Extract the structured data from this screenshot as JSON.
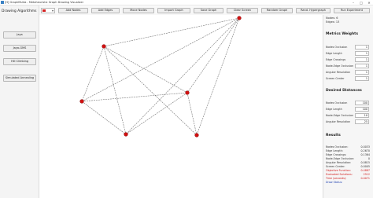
{
  "window": {
    "title": "[H] GraphMutta - Metaheuristic Graph Drawing Visualizer",
    "minimize": "–",
    "maximize": "□",
    "close": "✕"
  },
  "toolbar": {
    "node_color": "#d32020",
    "buttons": [
      "Add Nodes",
      "Add Edges",
      "Move Nodes",
      "Import Graph",
      "Save Graph",
      "Clear Screen",
      "Random Graph",
      "Rand. Hypergraph",
      "Run Experiment"
    ]
  },
  "sidebar": {
    "title": "Drawing Algorithms",
    "buttons": [
      "Jaya",
      "Jaya-GMS",
      "Hill Climbing",
      "Simulated Annealing"
    ]
  },
  "graph": {
    "node_color": "#d01010",
    "edge_color": "#777777",
    "nodes": [
      "N1",
      "N2",
      "N3",
      "N4",
      "N5",
      "N6"
    ],
    "edges": [
      [
        0,
        1
      ],
      [
        0,
        2
      ],
      [
        0,
        3
      ],
      [
        0,
        4
      ],
      [
        0,
        5
      ],
      [
        1,
        2
      ],
      [
        1,
        3
      ],
      [
        1,
        4
      ],
      [
        1,
        5
      ],
      [
        2,
        3
      ],
      [
        2,
        4
      ],
      [
        3,
        4
      ],
      [
        3,
        5
      ]
    ]
  },
  "right_panel": {
    "stats": [
      "Nodes: 6",
      "Edges: 13"
    ],
    "metric_weights": {
      "title": "Metrics Weights",
      "rows": [
        {
          "label": "Nodes Occlusion",
          "value": "1"
        },
        {
          "label": "Edge Length",
          "value": "1"
        },
        {
          "label": "Edge Crossings",
          "value": "1"
        },
        {
          "label": "Node-Edge Occlusion",
          "value": "1"
        },
        {
          "label": "Angular Resolution",
          "value": "1"
        },
        {
          "label": "Screen Center",
          "value": "1"
        }
      ]
    },
    "desired_distances": {
      "title": "Desired Distances",
      "rows": [
        {
          "label": "Nodes Occlusion",
          "value": "100"
        },
        {
          "label": "Edge Length",
          "value": "100"
        },
        {
          "label": "Node-Edge Occlusion",
          "value": "10"
        },
        {
          "label": "Angular Resolution",
          "value": "25"
        }
      ]
    },
    "results": {
      "title": "Results",
      "rows": [
        {
          "label": "Nodes Occlusion:",
          "value": "0.0033"
        },
        {
          "label": "Edge Length:",
          "value": "0.2670"
        },
        {
          "label": "Edge Crossings:",
          "value": "0.1364"
        },
        {
          "label": "Node-Edge Occlusion:",
          "value": "0"
        },
        {
          "label": "Angular Resolution:",
          "value": "0.0815"
        },
        {
          "label": "Screen Center:",
          "value": "0.0005"
        },
        {
          "label": "Objective Function:",
          "value": "0.4887",
          "color": "red"
        },
        {
          "label": "Evaluated Solutions:",
          "value": "2512",
          "color": "red"
        },
        {
          "label": "Time (seconds):",
          "value": "0.0071",
          "color": "red"
        },
        {
          "label": "Draw Status:",
          "value": "",
          "color": "blue"
        }
      ]
    }
  }
}
